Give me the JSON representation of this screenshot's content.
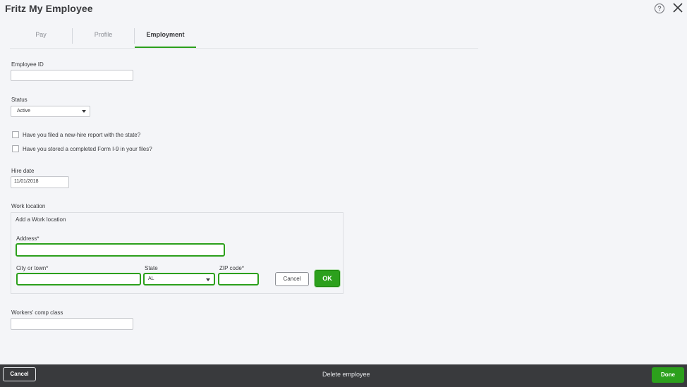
{
  "window": {
    "title": "Fritz My Employee"
  },
  "tabs": [
    {
      "label": "Pay"
    },
    {
      "label": "Profile"
    },
    {
      "label": "Employment"
    }
  ],
  "active_tab": "Employment",
  "form": {
    "employee_id": {
      "label": "Employee ID",
      "value": ""
    },
    "status": {
      "label": "Status",
      "value": "Active"
    },
    "new_hire_report": {
      "label": "Have you filed a new-hire report with the state?",
      "checked": false
    },
    "form_i9": {
      "label": "Have you stored a completed Form I-9 in your files?",
      "checked": false
    },
    "hire_date": {
      "label": "Hire date",
      "value": "11/01/2018"
    },
    "work_location": {
      "label": "Work location",
      "panel_title": "Add a Work location",
      "address": {
        "label": "Address*",
        "value": ""
      },
      "city": {
        "label": "City or town*",
        "value": ""
      },
      "state": {
        "label": "State",
        "value": "AL"
      },
      "zip": {
        "label": "ZIP code*",
        "value": ""
      },
      "cancel_label": "Cancel",
      "ok_label": "OK"
    },
    "workers_comp": {
      "label": "Workers' comp class",
      "value": ""
    }
  },
  "footer": {
    "cancel_label": "Cancel",
    "delete_label": "Delete employee",
    "done_label": "Done"
  },
  "colors": {
    "accent": "#2ca01c",
    "footer_bg": "#393a3d"
  }
}
